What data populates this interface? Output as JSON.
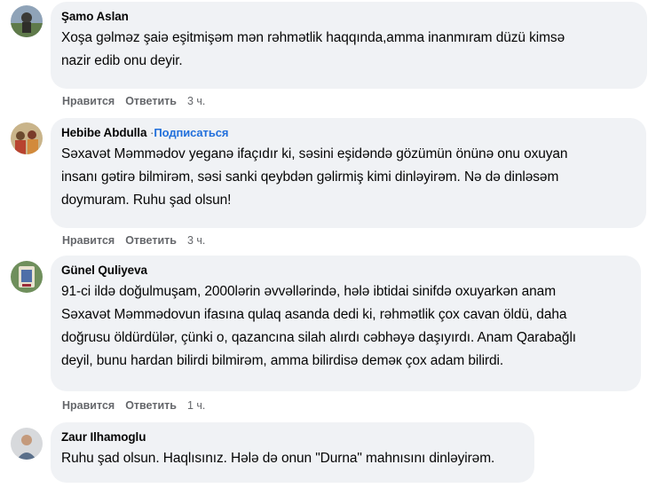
{
  "comments": [
    {
      "author": "Şamo Aslan",
      "follow": "",
      "text_lines": [
        "Xoşa gəlməz şaiə eşitmişəm mən rəhmətlik haqqında,amma inanmıram düzü kimsə",
        "nazir edib onu deyir."
      ],
      "like": "Нравится",
      "reply": "Ответить",
      "time": "3 ч."
    },
    {
      "author": "Hebibe Abdulla",
      "follow": "Подписаться",
      "text_lines": [
        "Səxavət Məmmədov yeganə ifaçıdır ki, səsini eşidəndə gözümün önünə onu oxuyan",
        "insanı gətirə bilmirəm, səsi sanki qeybdən gəlirmiş kimi dinləyirəm. Nə də dinləsəm",
        "doymuram. Ruhu şad olsun!"
      ],
      "like": "Нравится",
      "reply": "Ответить",
      "time": "3 ч."
    },
    {
      "author": "Günel Quliyeva",
      "follow": "",
      "text_lines": [
        "91-ci ildə doğulmuşam, 2000lərin əvvəllərində, hələ ibtidai sinifdə oxuyarkən anam",
        "Səxavət Məmmədovun ifasına qulaq asanda dedi ki, rəhmətlik çox cavan öldü, daha",
        "doğrusu öldürdülər, çünki o, qazancına silah alırdı cəbhəyə daşıyırdı. Anam Qarabağlı",
        "deyil, bunu hardan bilirdi bilmirəm, amma bilirdisə deməк çox adam bilirdi."
      ],
      "like": "Нравится",
      "reply": "Ответить",
      "time": "1 ч."
    },
    {
      "author": "Zaur Ilhamoglu",
      "follow": "",
      "text_lines": [
        "Ruhu şad olsun. Haqlısınız. Hələ də onun \"Durna\" mahnısını dinləyirəm."
      ],
      "like": "",
      "reply": "",
      "time": ""
    }
  ],
  "separator": "·"
}
